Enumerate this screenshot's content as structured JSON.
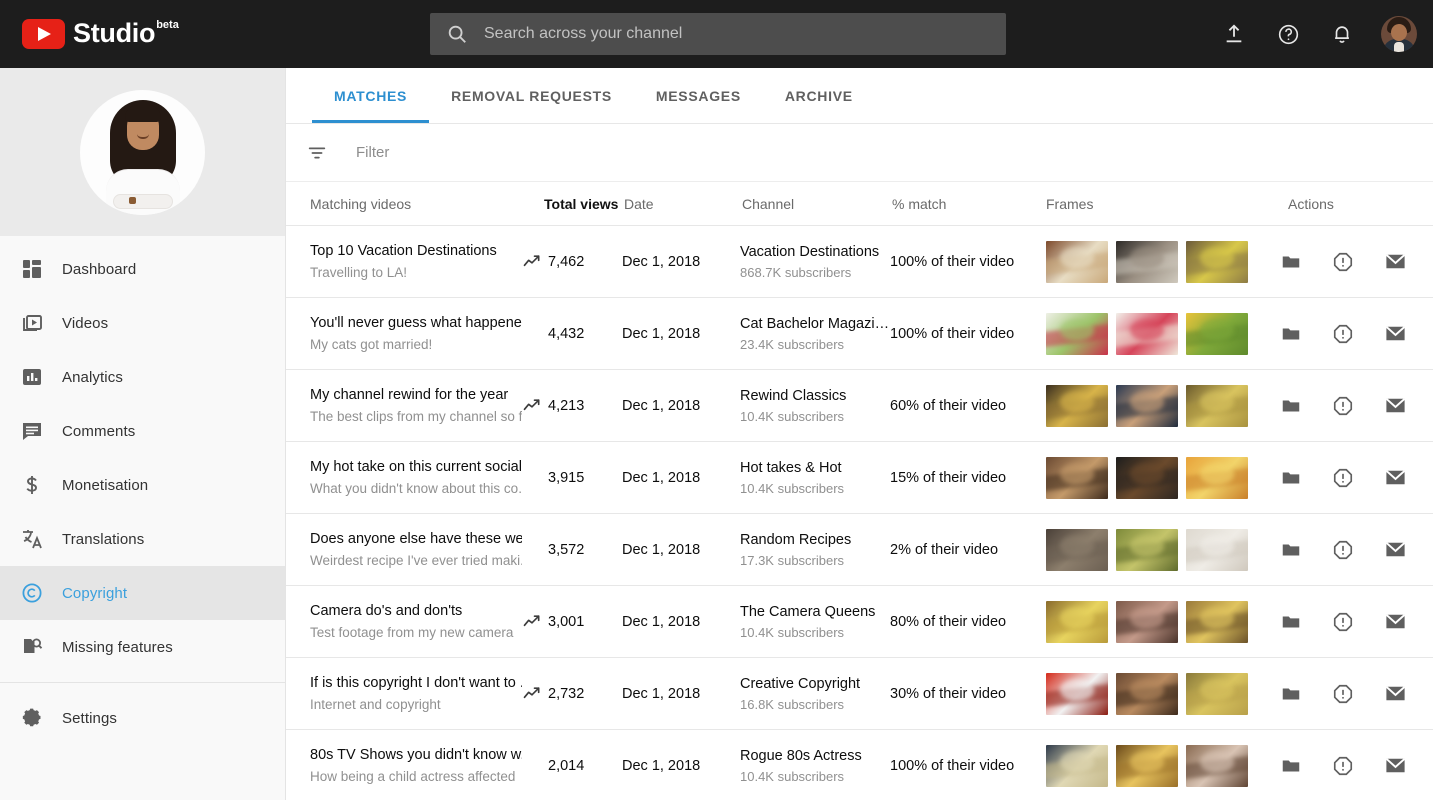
{
  "topbar": {
    "brand_name": "Studio",
    "brand_beta": "beta",
    "search_placeholder": "Search across your channel",
    "search_value": "",
    "icons": [
      "upload-icon",
      "help-icon",
      "notifications-icon",
      "account-avatar"
    ]
  },
  "sidebar": {
    "items": [
      {
        "label": "Dashboard",
        "icon": "dashboard-icon",
        "active": false
      },
      {
        "label": "Videos",
        "icon": "videos-icon",
        "active": false
      },
      {
        "label": "Analytics",
        "icon": "analytics-icon",
        "active": false
      },
      {
        "label": "Comments",
        "icon": "comments-icon",
        "active": false
      },
      {
        "label": "Monetisation",
        "icon": "dollar-icon",
        "active": false
      },
      {
        "label": "Translations",
        "icon": "translate-icon",
        "active": false
      },
      {
        "label": "Copyright",
        "icon": "copyright-icon",
        "active": true
      },
      {
        "label": "Missing features",
        "icon": "missing-features-icon",
        "active": false
      }
    ],
    "footer_items": [
      {
        "label": "Settings",
        "icon": "gear-icon"
      }
    ],
    "active_color": "#3ba0dd"
  },
  "main": {
    "tabs": [
      {
        "label": "MATCHES",
        "active": true
      },
      {
        "label": "REMOVAL REQUESTS",
        "active": false
      },
      {
        "label": "MESSAGES",
        "active": false
      },
      {
        "label": "ARCHIVE",
        "active": false
      }
    ],
    "filter": {
      "placeholder": "Filter",
      "value": "",
      "icon": "filter-icon"
    },
    "table": {
      "columns": [
        {
          "key": "title",
          "label": "Matching videos",
          "sorted": false
        },
        {
          "key": "views",
          "label": "Total views",
          "sorted": true
        },
        {
          "key": "date",
          "label": "Date",
          "sorted": false
        },
        {
          "key": "chan",
          "label": "Channel",
          "sorted": false
        },
        {
          "key": "match",
          "label": "% match",
          "sorted": false
        },
        {
          "key": "frames",
          "label": "Frames",
          "sorted": false
        },
        {
          "key": "act",
          "label": "Actions",
          "sorted": false
        }
      ],
      "action_icons": [
        "folder-icon",
        "report-icon",
        "mail-icon"
      ],
      "rows": [
        {
          "title": "Top 10 Vacation Destinations",
          "subtitle": "Travelling to LA!",
          "trending": true,
          "views": "7,462",
          "date": "Dec 1, 2018",
          "channel": "Vacation Destinations",
          "subscribers": "868.7K subscribers",
          "match": "100% of their video",
          "frames": [
            {
              "c1": "#7d4a2c",
              "c2": "#e8ddc4",
              "c3": "#c9a87a"
            },
            {
              "c1": "#2e2b28",
              "c2": "#9a8f82",
              "c3": "#cfc9bd"
            },
            {
              "c1": "#6b5a3a",
              "c2": "#d8c84a",
              "c3": "#8d7b45"
            }
          ]
        },
        {
          "title": "You'll never guess what happened",
          "subtitle": "My cats got married!",
          "trending": false,
          "views": "4,432",
          "date": "Dec 1, 2018",
          "channel": "Cat Bachelor Magazine",
          "subscribers": "23.4K subscribers",
          "match": "100% of their video",
          "frames": [
            {
              "c1": "#eef0e6",
              "c2": "#9dc46a",
              "c3": "#c8314a"
            },
            {
              "c1": "#f2f0ea",
              "c2": "#d6455a",
              "c3": "#efe7da"
            },
            {
              "c1": "#e8c33a",
              "c2": "#7fa93a",
              "c3": "#5f8a2c"
            }
          ]
        },
        {
          "title": "My channel rewind for the year",
          "subtitle": "The best clips from my channel so far",
          "trending": true,
          "views": "4,213",
          "date": "Dec 1, 2018",
          "channel": "Rewind Classics",
          "subscribers": "10.4K subscribers",
          "match": "60% of their video",
          "frames": [
            {
              "c1": "#3a2e1e",
              "c2": "#d8b44a",
              "c3": "#8a6e33"
            },
            {
              "c1": "#2b3a52",
              "c2": "#c9a07a",
              "c3": "#1f2b3d"
            },
            {
              "c1": "#6b5a2c",
              "c2": "#d9c45f",
              "c3": "#a8923f"
            }
          ]
        },
        {
          "title": "My hot take on this current social",
          "subtitle": "What you didn't know about this co...",
          "trending": false,
          "views": "3,915",
          "date": "Dec 1, 2018",
          "channel": "Hot takes & Hot",
          "subscribers": "10.4K subscribers",
          "match": "15% of their video",
          "frames": [
            {
              "c1": "#6b4a33",
              "c2": "#c49a6a",
              "c3": "#3d2a1c"
            },
            {
              "c1": "#1d1d1d",
              "c2": "#6b4a2c",
              "c3": "#2e2722"
            },
            {
              "c1": "#e8a33a",
              "c2": "#f2d46a",
              "c3": "#c97f2a"
            }
          ]
        },
        {
          "title": "Does anyone else have these wei...",
          "subtitle": "Weirdest recipe I've ever tried maki...",
          "trending": false,
          "views": "3,572",
          "date": "Dec 1, 2018",
          "channel": "Random Recipes",
          "subscribers": "17.3K subscribers",
          "match": "2% of their video",
          "frames": [
            {
              "c1": "#4a4038",
              "c2": "#8d7f6d",
              "c3": "#6b5f52"
            },
            {
              "c1": "#7d8a3a",
              "c2": "#c4c46a",
              "c3": "#5f6b2c"
            },
            {
              "c1": "#ded9d0",
              "c2": "#efece6",
              "c3": "#cfc8bd"
            }
          ]
        },
        {
          "title": "Camera do's and don'ts",
          "subtitle": "Test footage from my new camera",
          "trending": true,
          "views": "3,001",
          "date": "Dec 1, 2018",
          "channel": "The Camera Queens",
          "subscribers": "10.4K subscribers",
          "match": "80% of their video",
          "frames": [
            {
              "c1": "#8a6b2c",
              "c2": "#e8d45f",
              "c3": "#b89a3a"
            },
            {
              "c1": "#7d5a4a",
              "c2": "#c49a8a",
              "c3": "#4a332a"
            },
            {
              "c1": "#9a7a3a",
              "c2": "#e0c45f",
              "c3": "#6b5229"
            }
          ]
        },
        {
          "title": "If is this copyright I don't want to ...",
          "subtitle": "Internet and copyright",
          "trending": true,
          "views": "2,732",
          "date": "Dec 1, 2018",
          "channel": "Creative Copyright",
          "subscribers": "16.8K subscribers",
          "match": "30% of their video",
          "frames": [
            {
              "c1": "#d42a1a",
              "c2": "#f2f2f2",
              "c3": "#8a1a10"
            },
            {
              "c1": "#6b4a33",
              "c2": "#b88a5f",
              "c3": "#3d2a1c"
            },
            {
              "c1": "#8a7a3a",
              "c2": "#d9c45f",
              "c3": "#b8a04a"
            }
          ]
        },
        {
          "title": "80s TV Shows you didn't know w...",
          "subtitle": "How being a child actress affected",
          "trending": false,
          "views": "2,014",
          "date": "Dec 1, 2018",
          "channel": "Rogue 80s Actress",
          "subscribers": "10.4K subscribers",
          "match": "100% of their video",
          "frames": [
            {
              "c1": "#2e3a4a",
              "c2": "#e0d8b4",
              "c3": "#c4b88a"
            },
            {
              "c1": "#6b4a1a",
              "c2": "#e8c45f",
              "c3": "#9a7029"
            },
            {
              "c1": "#8a6b52",
              "c2": "#d9c4b4",
              "c3": "#5f4433"
            }
          ]
        }
      ]
    }
  }
}
